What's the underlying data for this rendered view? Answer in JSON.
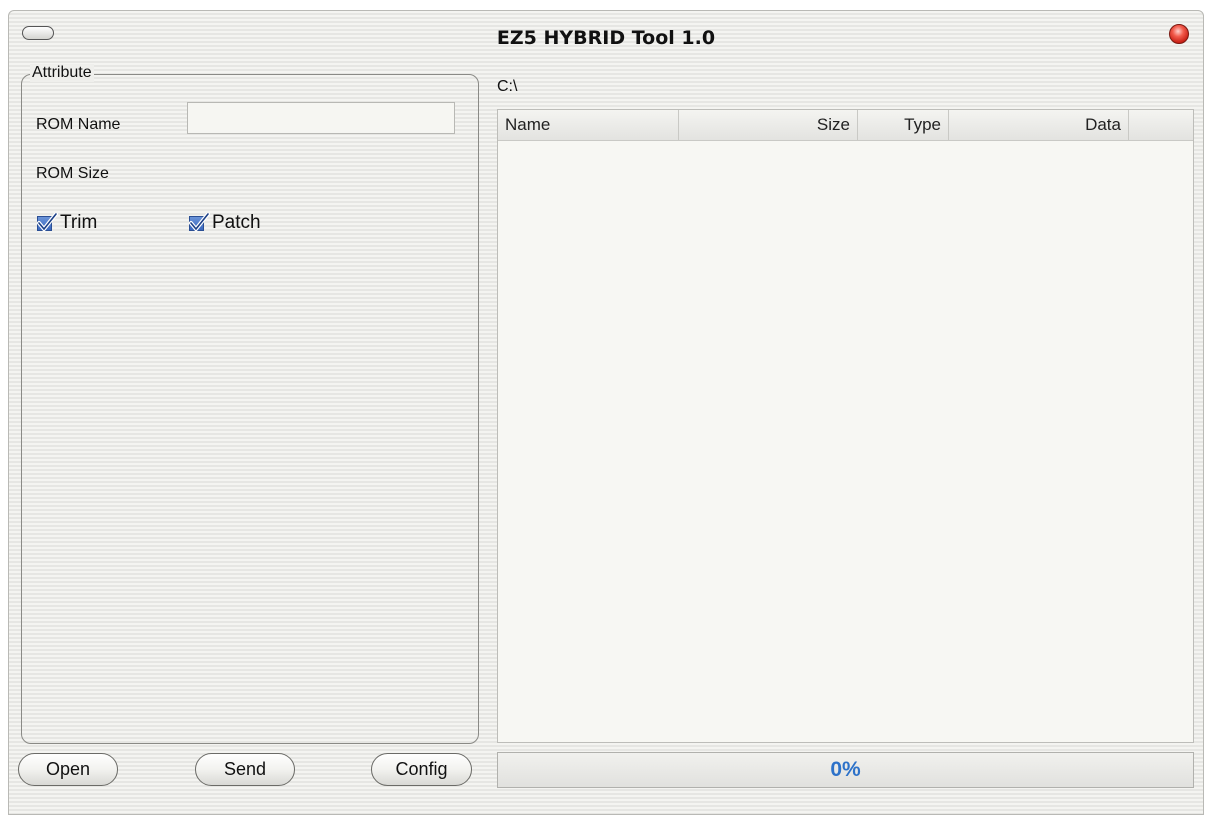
{
  "window": {
    "title": "EZ5 HYBRID Tool 1.0"
  },
  "attribute": {
    "legend": "Attribute",
    "rom_name_label": "ROM Name",
    "rom_name_value": "",
    "rom_size_label": "ROM Size",
    "trim_label": "Trim",
    "trim_checked": true,
    "patch_label": "Patch",
    "patch_checked": true
  },
  "buttons": {
    "open": "Open",
    "send": "Send",
    "config": "Config"
  },
  "browser": {
    "path": "C:\\",
    "columns": [
      "Name",
      "Size",
      "Type",
      "Data"
    ],
    "rows": []
  },
  "progress": {
    "text": "0%",
    "value": 0
  },
  "colors": {
    "progress_text": "#2d72c9",
    "checkbox": "#3a68bf",
    "close_button": "#e0392b"
  },
  "icons": {
    "minimize": "pill-button-icon",
    "close": "close-icon",
    "checkmark": "checkmark-icon"
  }
}
